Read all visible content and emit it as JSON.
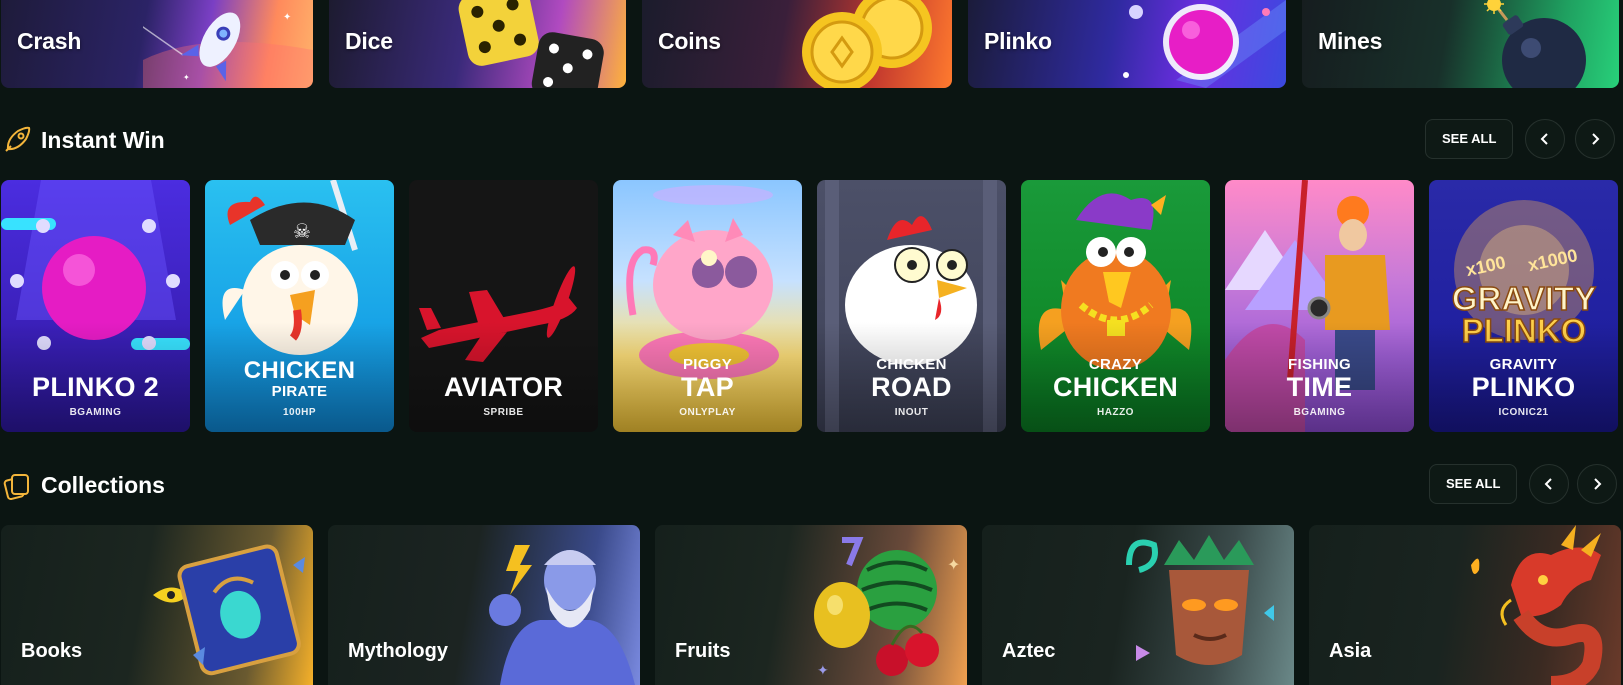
{
  "categories": [
    {
      "label": "Crash",
      "icon": "rocket-icon"
    },
    {
      "label": "Dice",
      "icon": "dice-icon"
    },
    {
      "label": "Coins",
      "icon": "coin-icon"
    },
    {
      "label": "Plinko",
      "icon": "ball-icon"
    },
    {
      "label": "Mines",
      "icon": "bomb-icon"
    }
  ],
  "instant_win": {
    "title": "Instant Win",
    "icon": "rocket-icon",
    "see_all": "SEE ALL",
    "games": [
      {
        "small": "",
        "big": "PLINKO 2",
        "provider": "BGAMING"
      },
      {
        "small": "CHICKEN",
        "big": "PIRATE",
        "provider": "100HP"
      },
      {
        "small": "",
        "big": "AVIATOR",
        "provider": "SPRIBE"
      },
      {
        "small": "PIGGY",
        "big": "TAP",
        "provider": "ONLYPLAY"
      },
      {
        "small": "CHICKEN",
        "big": "ROAD",
        "provider": "INOUT"
      },
      {
        "small": "CRAZY",
        "big": "CHICKEN",
        "provider": "HAZZO"
      },
      {
        "small": "FISHING",
        "big": "TIME",
        "provider": "BGAMING"
      },
      {
        "small": "GRAVITY",
        "big": "PLINKO",
        "provider": "ICONIC21"
      }
    ]
  },
  "collections": {
    "title": "Collections",
    "icon": "cards-icon",
    "see_all": "SEE ALL",
    "items": [
      {
        "label": "Books",
        "icon": "book-icon"
      },
      {
        "label": "Mythology",
        "icon": "god-icon"
      },
      {
        "label": "Fruits",
        "icon": "fruit-icon"
      },
      {
        "label": "Aztec",
        "icon": "mask-icon"
      },
      {
        "label": "Asia",
        "icon": "dragon-icon"
      }
    ]
  },
  "colors": {
    "background": "#0b1512",
    "accent": "#f3b53b",
    "card_border": "#26312d"
  }
}
